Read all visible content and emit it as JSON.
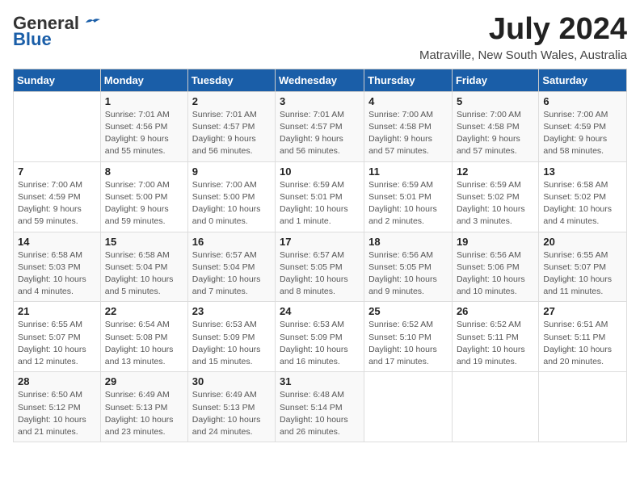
{
  "logo": {
    "general": "General",
    "blue": "Blue"
  },
  "title": "July 2024",
  "location": "Matraville, New South Wales, Australia",
  "days_of_week": [
    "Sunday",
    "Monday",
    "Tuesday",
    "Wednesday",
    "Thursday",
    "Friday",
    "Saturday"
  ],
  "weeks": [
    [
      {
        "day": "",
        "info": ""
      },
      {
        "day": "1",
        "info": "Sunrise: 7:01 AM\nSunset: 4:56 PM\nDaylight: 9 hours\nand 55 minutes."
      },
      {
        "day": "2",
        "info": "Sunrise: 7:01 AM\nSunset: 4:57 PM\nDaylight: 9 hours\nand 56 minutes."
      },
      {
        "day": "3",
        "info": "Sunrise: 7:01 AM\nSunset: 4:57 PM\nDaylight: 9 hours\nand 56 minutes."
      },
      {
        "day": "4",
        "info": "Sunrise: 7:00 AM\nSunset: 4:58 PM\nDaylight: 9 hours\nand 57 minutes."
      },
      {
        "day": "5",
        "info": "Sunrise: 7:00 AM\nSunset: 4:58 PM\nDaylight: 9 hours\nand 57 minutes."
      },
      {
        "day": "6",
        "info": "Sunrise: 7:00 AM\nSunset: 4:59 PM\nDaylight: 9 hours\nand 58 minutes."
      }
    ],
    [
      {
        "day": "7",
        "info": "Sunrise: 7:00 AM\nSunset: 4:59 PM\nDaylight: 9 hours\nand 59 minutes."
      },
      {
        "day": "8",
        "info": "Sunrise: 7:00 AM\nSunset: 5:00 PM\nDaylight: 9 hours\nand 59 minutes."
      },
      {
        "day": "9",
        "info": "Sunrise: 7:00 AM\nSunset: 5:00 PM\nDaylight: 10 hours\nand 0 minutes."
      },
      {
        "day": "10",
        "info": "Sunrise: 6:59 AM\nSunset: 5:01 PM\nDaylight: 10 hours\nand 1 minute."
      },
      {
        "day": "11",
        "info": "Sunrise: 6:59 AM\nSunset: 5:01 PM\nDaylight: 10 hours\nand 2 minutes."
      },
      {
        "day": "12",
        "info": "Sunrise: 6:59 AM\nSunset: 5:02 PM\nDaylight: 10 hours\nand 3 minutes."
      },
      {
        "day": "13",
        "info": "Sunrise: 6:58 AM\nSunset: 5:02 PM\nDaylight: 10 hours\nand 4 minutes."
      }
    ],
    [
      {
        "day": "14",
        "info": "Sunrise: 6:58 AM\nSunset: 5:03 PM\nDaylight: 10 hours\nand 4 minutes."
      },
      {
        "day": "15",
        "info": "Sunrise: 6:58 AM\nSunset: 5:04 PM\nDaylight: 10 hours\nand 5 minutes."
      },
      {
        "day": "16",
        "info": "Sunrise: 6:57 AM\nSunset: 5:04 PM\nDaylight: 10 hours\nand 7 minutes."
      },
      {
        "day": "17",
        "info": "Sunrise: 6:57 AM\nSunset: 5:05 PM\nDaylight: 10 hours\nand 8 minutes."
      },
      {
        "day": "18",
        "info": "Sunrise: 6:56 AM\nSunset: 5:05 PM\nDaylight: 10 hours\nand 9 minutes."
      },
      {
        "day": "19",
        "info": "Sunrise: 6:56 AM\nSunset: 5:06 PM\nDaylight: 10 hours\nand 10 minutes."
      },
      {
        "day": "20",
        "info": "Sunrise: 6:55 AM\nSunset: 5:07 PM\nDaylight: 10 hours\nand 11 minutes."
      }
    ],
    [
      {
        "day": "21",
        "info": "Sunrise: 6:55 AM\nSunset: 5:07 PM\nDaylight: 10 hours\nand 12 minutes."
      },
      {
        "day": "22",
        "info": "Sunrise: 6:54 AM\nSunset: 5:08 PM\nDaylight: 10 hours\nand 13 minutes."
      },
      {
        "day": "23",
        "info": "Sunrise: 6:53 AM\nSunset: 5:09 PM\nDaylight: 10 hours\nand 15 minutes."
      },
      {
        "day": "24",
        "info": "Sunrise: 6:53 AM\nSunset: 5:09 PM\nDaylight: 10 hours\nand 16 minutes."
      },
      {
        "day": "25",
        "info": "Sunrise: 6:52 AM\nSunset: 5:10 PM\nDaylight: 10 hours\nand 17 minutes."
      },
      {
        "day": "26",
        "info": "Sunrise: 6:52 AM\nSunset: 5:11 PM\nDaylight: 10 hours\nand 19 minutes."
      },
      {
        "day": "27",
        "info": "Sunrise: 6:51 AM\nSunset: 5:11 PM\nDaylight: 10 hours\nand 20 minutes."
      }
    ],
    [
      {
        "day": "28",
        "info": "Sunrise: 6:50 AM\nSunset: 5:12 PM\nDaylight: 10 hours\nand 21 minutes."
      },
      {
        "day": "29",
        "info": "Sunrise: 6:49 AM\nSunset: 5:13 PM\nDaylight: 10 hours\nand 23 minutes."
      },
      {
        "day": "30",
        "info": "Sunrise: 6:49 AM\nSunset: 5:13 PM\nDaylight: 10 hours\nand 24 minutes."
      },
      {
        "day": "31",
        "info": "Sunrise: 6:48 AM\nSunset: 5:14 PM\nDaylight: 10 hours\nand 26 minutes."
      },
      {
        "day": "",
        "info": ""
      },
      {
        "day": "",
        "info": ""
      },
      {
        "day": "",
        "info": ""
      }
    ]
  ]
}
